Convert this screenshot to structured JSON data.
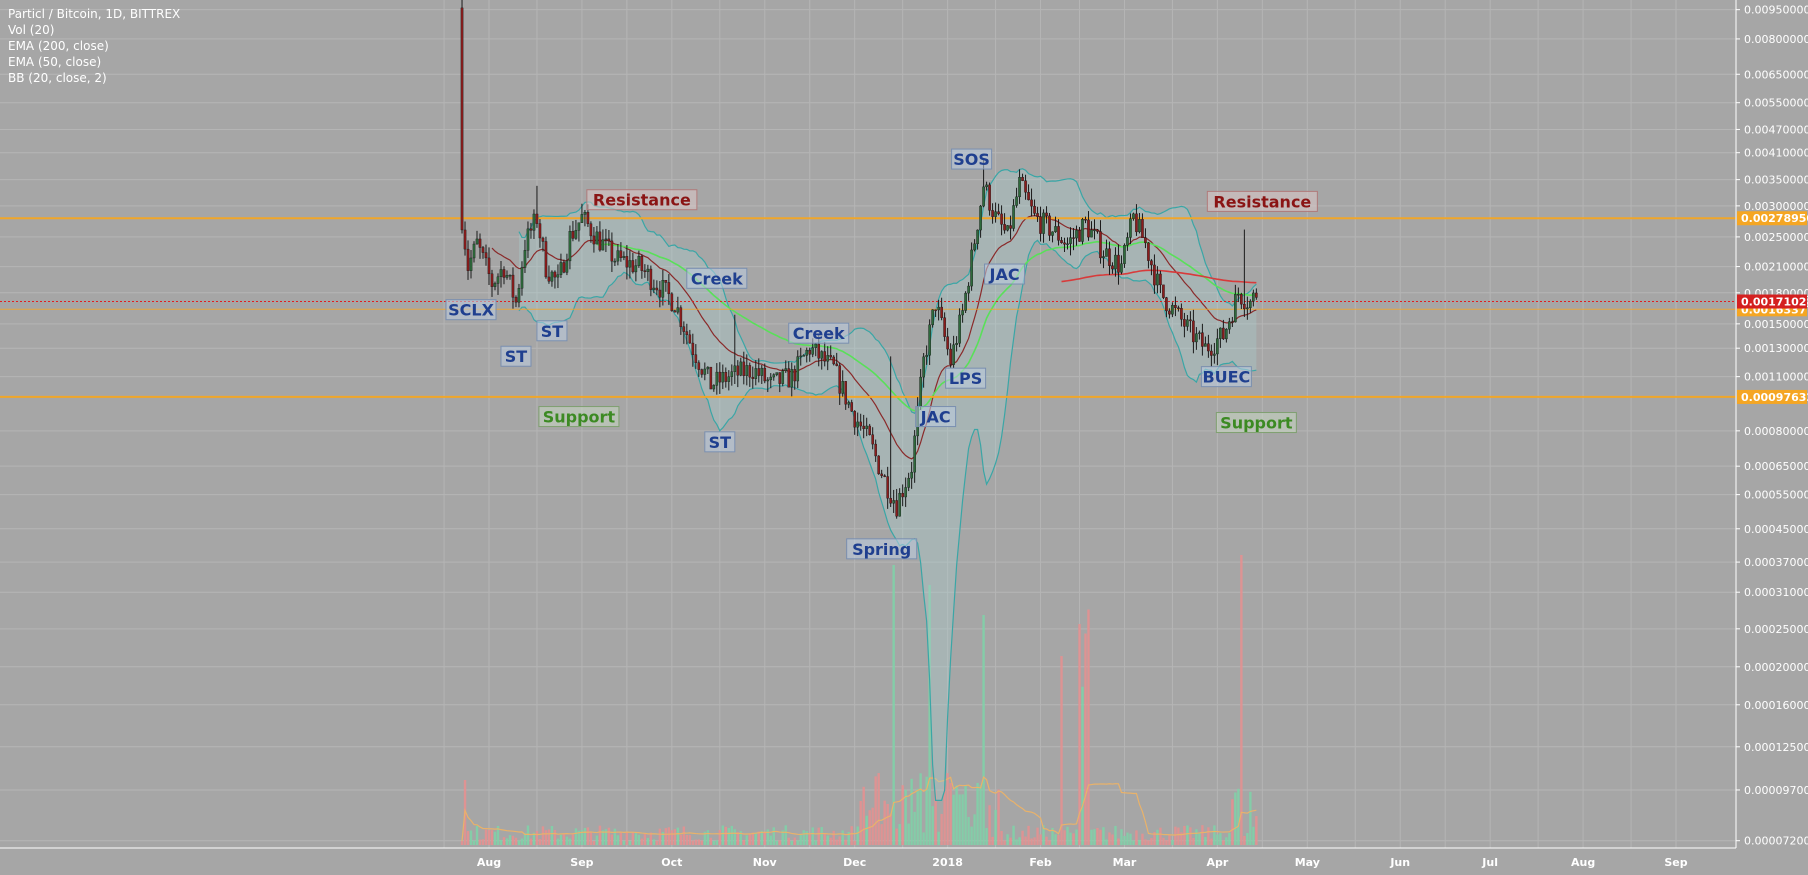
{
  "legend": {
    "title": "Particl / Bitcoin, 1D, BITTREX",
    "indicators": [
      "Vol (20)",
      "EMA (200, close)",
      "EMA (50, close)",
      "BB (20, close, 2)"
    ]
  },
  "colors": {
    "background": "#a6a6a6",
    "grid": "#b5b5b5",
    "up_candle": "#2e6b3c",
    "down_candle": "#8c1d1d",
    "level_line": "#f5a623",
    "last_price_line": "#e02020",
    "bb_band": "#3aa6a6",
    "ema50": "#59e059",
    "ema200": "#d83a3a",
    "ema20": "#8a2a2a",
    "label_blue": "#1f3f8f",
    "label_green": "#3c8a23",
    "label_red": "#8a1414",
    "vol_up": "#7ed3a8",
    "vol_down": "#e88f8f",
    "vol_ma": "#e9b26a"
  },
  "chart_data": {
    "type": "candlestick",
    "x_axis_labels": [
      "Aug",
      "Sep",
      "Oct",
      "Nov",
      "Dec",
      "2018",
      "Feb",
      "Mar",
      "Apr",
      "May",
      "Jun",
      "Jul",
      "Aug",
      "Sep"
    ],
    "y_axis_labels": [
      "0.00950000",
      "0.00800000",
      "0.00650000",
      "0.00550000",
      "0.00470000",
      "0.00410000",
      "0.00350000",
      "0.00300000",
      "0.00250000",
      "0.00210000",
      "0.00180000",
      "0.00150000",
      "0.00130000",
      "0.00110000",
      "0.00080000",
      "0.00065000",
      "0.00055000",
      "0.00045000",
      "0.00037000",
      "0.00031000",
      "0.00025000",
      "0.00020000",
      "0.00016000",
      "0.00012500",
      "0.00009700",
      "0.00007200"
    ],
    "y_scale": "log",
    "ylim": [
      7.02e-05,
      0.00965
    ],
    "horizontal_levels": [
      {
        "value": 0.0027895,
        "label": "0.00278950",
        "color": "#f5a623"
      },
      {
        "value": 0.00097632,
        "label": "0.00097632",
        "color": "#f5a623"
      },
      {
        "value": 0.00163377,
        "label": "0.00163377",
        "color": "#f5a623"
      }
    ],
    "last_price": {
      "value": 0.00171028,
      "label": "0.00171028"
    },
    "price_keypoints": [
      {
        "date": "2017-07-23",
        "open": 0.0096,
        "close": 0.0028
      },
      {
        "date": "2017-07-25",
        "close": 0.0021
      },
      {
        "date": "2017-07-28",
        "close": 0.0024
      },
      {
        "date": "2017-08-02",
        "close": 0.0019
      },
      {
        "date": "2017-08-06",
        "close": 0.0021
      },
      {
        "date": "2017-08-10",
        "close": 0.0017
      },
      {
        "date": "2017-08-13",
        "close": 0.0024
      },
      {
        "date": "2017-08-17",
        "close": 0.0028
      },
      {
        "date": "2017-08-20",
        "close": 0.0021
      },
      {
        "date": "2017-08-24",
        "close": 0.0019
      },
      {
        "date": "2017-08-28",
        "close": 0.0025
      },
      {
        "date": "2017-09-01",
        "close": 0.0028
      },
      {
        "date": "2017-09-06",
        "close": 0.0025
      },
      {
        "date": "2017-09-12",
        "close": 0.0022
      },
      {
        "date": "2017-09-20",
        "close": 0.0021
      },
      {
        "date": "2017-09-26",
        "close": 0.0019
      },
      {
        "date": "2017-10-02",
        "close": 0.0017
      },
      {
        "date": "2017-10-08",
        "close": 0.0013
      },
      {
        "date": "2017-10-14",
        "close": 0.00105
      },
      {
        "date": "2017-10-20",
        "close": 0.0011
      },
      {
        "date": "2017-10-28",
        "close": 0.00115
      },
      {
        "date": "2017-11-03",
        "close": 0.00105
      },
      {
        "date": "2017-11-10",
        "close": 0.0011
      },
      {
        "date": "2017-11-16",
        "close": 0.0013
      },
      {
        "date": "2017-11-24",
        "close": 0.00115
      },
      {
        "date": "2017-11-30",
        "close": 0.0009
      },
      {
        "date": "2017-12-06",
        "close": 0.00075
      },
      {
        "date": "2017-12-11",
        "close": 0.0006
      },
      {
        "date": "2017-12-15",
        "close": 0.00052
      },
      {
        "date": "2017-12-20",
        "close": 0.00065
      },
      {
        "date": "2017-12-24",
        "close": 0.0012
      },
      {
        "date": "2017-12-28",
        "close": 0.0017
      },
      {
        "date": "2018-01-02",
        "close": 0.0012
      },
      {
        "date": "2018-01-06",
        "close": 0.0016
      },
      {
        "date": "2018-01-09",
        "close": 0.0022
      },
      {
        "date": "2018-01-13",
        "close": 0.0034
      },
      {
        "date": "2018-01-17",
        "close": 0.0028
      },
      {
        "date": "2018-01-21",
        "close": 0.0025
      },
      {
        "date": "2018-01-25",
        "close": 0.0034
      },
      {
        "date": "2018-01-30",
        "close": 0.0028
      },
      {
        "date": "2018-02-05",
        "close": 0.0026
      },
      {
        "date": "2018-02-10",
        "close": 0.0024
      },
      {
        "date": "2018-02-16",
        "close": 0.0027
      },
      {
        "date": "2018-02-22",
        "close": 0.0023
      },
      {
        "date": "2018-02-28",
        "close": 0.0021
      },
      {
        "date": "2018-03-04",
        "close": 0.0028
      },
      {
        "date": "2018-03-08",
        "close": 0.0024
      },
      {
        "date": "2018-03-13",
        "close": 0.0018
      },
      {
        "date": "2018-03-18",
        "close": 0.0016
      },
      {
        "date": "2018-03-24",
        "close": 0.0014
      },
      {
        "date": "2018-03-28",
        "close": 0.0013
      },
      {
        "date": "2018-04-03",
        "close": 0.0014
      },
      {
        "date": "2018-04-08",
        "close": 0.0018
      },
      {
        "date": "2018-04-12",
        "close": 0.0017
      },
      {
        "date": "2018-04-14",
        "close": 0.0018
      }
    ],
    "annotations": [
      {
        "text": "SCLX",
        "date": "2017-07-26",
        "price": 0.00163,
        "style": "blue"
      },
      {
        "text": "ST",
        "date": "2017-08-10",
        "price": 0.00124,
        "style": "blue"
      },
      {
        "text": "ST",
        "date": "2017-08-22",
        "price": 0.00144,
        "style": "blue"
      },
      {
        "text": "Resistance",
        "date": "2017-09-21",
        "price": 0.00311,
        "style": "red"
      },
      {
        "text": "Creek",
        "date": "2017-10-16",
        "price": 0.00196,
        "style": "blue"
      },
      {
        "text": "Support",
        "date": "2017-08-31",
        "price": 0.00087,
        "style": "green"
      },
      {
        "text": "ST",
        "date": "2017-10-17",
        "price": 0.00075,
        "style": "blue"
      },
      {
        "text": "Creek",
        "date": "2017-11-19",
        "price": 0.00142,
        "style": "blue"
      },
      {
        "text": "Spring",
        "date": "2017-12-10",
        "price": 0.0004,
        "style": "blue"
      },
      {
        "text": "JAC",
        "date": "2017-12-28",
        "price": 0.00087,
        "style": "blue"
      },
      {
        "text": "LPS",
        "date": "2018-01-07",
        "price": 0.00109,
        "style": "blue"
      },
      {
        "text": "SOS",
        "date": "2018-01-09",
        "price": 0.00395,
        "style": "blue"
      },
      {
        "text": "JAC",
        "date": "2018-01-20",
        "price": 0.00201,
        "style": "blue"
      },
      {
        "text": "Resistance",
        "date": "2018-04-16",
        "price": 0.00308,
        "style": "red"
      },
      {
        "text": "BUEC",
        "date": "2018-04-04",
        "price": 0.0011,
        "style": "blue"
      },
      {
        "text": "Support",
        "date": "2018-04-14",
        "price": 0.00084,
        "style": "green"
      }
    ]
  }
}
